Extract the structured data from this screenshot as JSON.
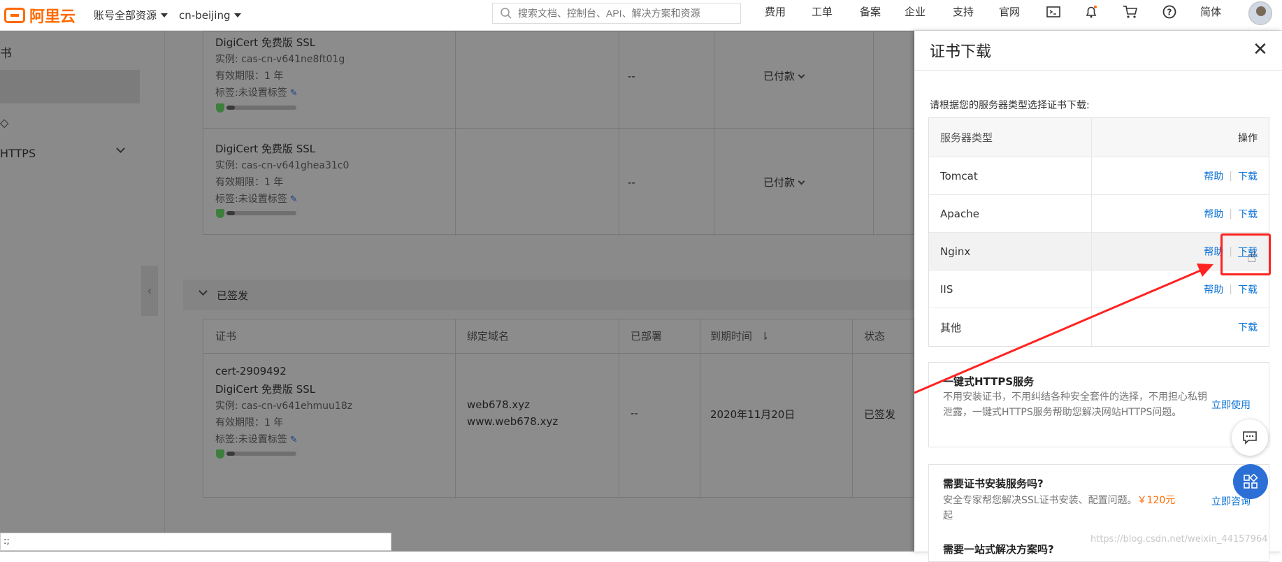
{
  "topbar": {
    "logo": "阿里云",
    "account_scope": "账号全部资源",
    "region": "cn-beijing",
    "search_placeholder": "搜索文档、控制台、API、解决方案和资源",
    "nav": [
      "费用",
      "工单",
      "备案",
      "企业",
      "支持",
      "官网"
    ],
    "lang": "简体"
  },
  "sidebar": {
    "title": "书",
    "item_https": "HTTPS"
  },
  "upper_certs": [
    {
      "name": "DigiCert 免费版 SSL",
      "instance": "实例: cas-cn-v641ne8ft01g",
      "validity": "有效期限：1 年",
      "tag": "标签:未设置标签",
      "deployed": "--",
      "status": "已付款"
    },
    {
      "name": "DigiCert 免费版 SSL",
      "instance": "实例: cas-cn-v641ghea31c0",
      "validity": "有效期限：1 年",
      "tag": "标签:未设置标签",
      "deployed": "--",
      "status": "已付款"
    }
  ],
  "issued_section": {
    "label": "已签发",
    "headers": [
      "证书",
      "绑定域名",
      "已部署",
      "到期时间",
      "状态"
    ],
    "row": {
      "cert_id": "cert-2909492",
      "name": "DigiCert 免费版 SSL",
      "instance": "实例: cas-cn-v641ehmuu18z",
      "validity": "有效期限：1 年",
      "tag": "标签:未设置标签",
      "domain1": "web678.xyz",
      "domain2": "www.web678.xyz",
      "deployed": "--",
      "expiry": "2020年11月20日",
      "status": "已签发"
    }
  },
  "panel": {
    "title": "证书下载",
    "instruction": "请根据您的服务器类型选择证书下载:",
    "col_server": "服务器类型",
    "col_action": "操作",
    "help_label": "帮助",
    "download_label": "下载",
    "servers": [
      "Tomcat",
      "Apache",
      "Nginx",
      "IIS",
      "其他"
    ],
    "https_box": {
      "title": "一键式HTTPS服务",
      "text": "不用安装证书，不用纠结各种安全套件的选择，不用担心私钥泄露，一键式HTTPS服务帮助您解决网站HTTPS问题。",
      "link": "立即使用"
    },
    "install_box": {
      "title": "需要证书安装服务吗?",
      "text": "安全专家帮您解决SSL证书安装、配置问题。",
      "price": "￥120元",
      "text_tail": "起",
      "link": "立即咨询"
    },
    "solution_box": {
      "title": "需要一站式解决方案吗?"
    }
  },
  "watermark": "https://blog.csdn.net/weixin_44157964",
  "status_strip": ":;"
}
